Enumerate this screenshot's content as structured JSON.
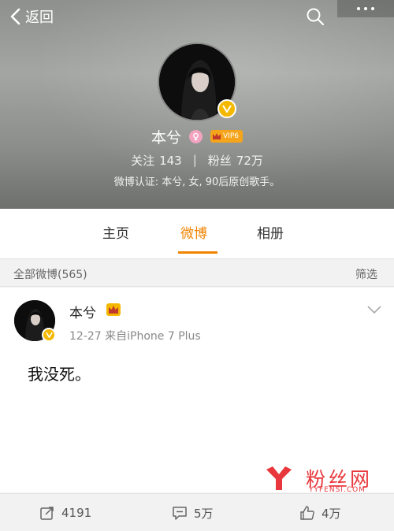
{
  "header": {
    "back_label": "返回",
    "name": "本兮",
    "vip_label": "VIP6",
    "following_label": "关注",
    "following_count": "143",
    "followers_label": "粉丝",
    "followers_count": "72万",
    "verified_text": "微博认证: 本兮, 女, 90后原创歌手。"
  },
  "tabs": [
    {
      "label": "主页"
    },
    {
      "label": "微博",
      "active": true
    },
    {
      "label": "相册"
    }
  ],
  "filter": {
    "title": "全部微博(565)",
    "button": "筛选"
  },
  "post": {
    "author": "本兮",
    "meta": "12-27  来自iPhone 7 Plus",
    "text": "我没死。"
  },
  "actions": {
    "reposts": "4191",
    "comments": "5万",
    "likes": "4万"
  },
  "watermark": {
    "text": "粉丝网",
    "url": "YYFENSI.COM"
  },
  "colors": {
    "accent": "#f08400",
    "badge": "#f5b800",
    "watermark": "#e8383d"
  }
}
